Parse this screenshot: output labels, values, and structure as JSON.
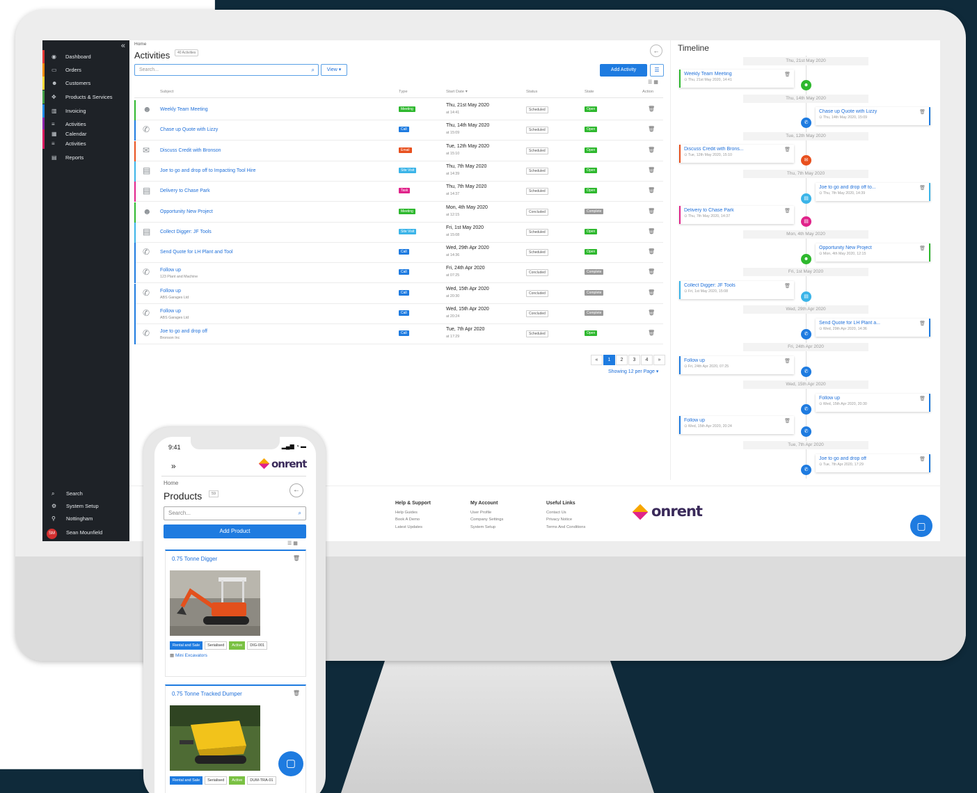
{
  "sidebar": {
    "items": [
      {
        "label": "Dashboard",
        "icon": "dashboard-icon",
        "color": "#e53935"
      },
      {
        "label": "Orders",
        "icon": "orders-icon",
        "color": "#fb8c00"
      },
      {
        "label": "Customers",
        "icon": "customers-icon",
        "color": "#fdd835"
      },
      {
        "label": "Products & Services",
        "icon": "products-icon",
        "color": "#43a047"
      },
      {
        "label": "Invoicing",
        "icon": "invoicing-icon",
        "color": "#1e88e5"
      },
      {
        "label": "Activities",
        "icon": "activities-icon",
        "color": "#8e24aa"
      },
      {
        "label": "Calendar",
        "icon": "calendar-icon",
        "color": "#d81b60"
      },
      {
        "label": "Activities",
        "icon": "activities-icon",
        "color": "#d81b60"
      },
      {
        "label": "Reports",
        "icon": "reports-icon",
        "color": ""
      }
    ],
    "bottom": [
      {
        "label": "Search",
        "icon": "search-icon"
      },
      {
        "label": "System Setup",
        "icon": "gear-icon"
      },
      {
        "label": "Nottingham",
        "icon": "location-pin-icon"
      },
      {
        "label": "Sean Mounfield",
        "icon": "avatar",
        "initials": "SM"
      }
    ]
  },
  "main": {
    "breadcrumb": "Home",
    "title": "Activities",
    "count": "40 Activities",
    "search_placeholder": "Search...",
    "view_label": "View ▾",
    "add_label": "Add Activity",
    "columns": [
      "Subject",
      "Type",
      "Start Date ▾",
      "Status",
      "State",
      "Action"
    ],
    "rows": [
      {
        "subject": "Weekly Team Meeting",
        "sub": "",
        "type": "Meeting",
        "type_color": "#2eb82e",
        "date": "Thu, 21st May 2020",
        "time": "at 14:41",
        "status": "Scheduled",
        "state": "Open",
        "state_color": "#2eb82e",
        "bar": "#2eb82e",
        "icon": "meeting-icon"
      },
      {
        "subject": "Chase up Quote with Lizzy",
        "sub": "",
        "type": "Call",
        "type_color": "#1e7be0",
        "date": "Thu, 14th May 2020",
        "time": "at 15:09",
        "status": "Scheduled",
        "state": "Open",
        "state_color": "#2eb82e",
        "bar": "#1e7be0",
        "icon": "phone-icon"
      },
      {
        "subject": "Discuss Credit with Bronson",
        "sub": "",
        "type": "Email",
        "type_color": "#e8501e",
        "date": "Tue, 12th May 2020",
        "time": "at 15:10",
        "status": "Scheduled",
        "state": "Open",
        "state_color": "#2eb82e",
        "bar": "#e8501e",
        "icon": "email-icon"
      },
      {
        "subject": "Joe to go and drop off to Impacting Tool Hire",
        "sub": "",
        "type": "Site Visit",
        "type_color": "#3bb4e8",
        "date": "Thu, 7th May 2020",
        "time": "at 14:39",
        "status": "Scheduled",
        "state": "Open",
        "state_color": "#2eb82e",
        "bar": "#3bb4e8",
        "icon": "site-visit-icon"
      },
      {
        "subject": "Delivery to Chase Park",
        "sub": "",
        "type": "Task",
        "type_color": "#e0238a",
        "date": "Thu, 7th May 2020",
        "time": "at 14:37",
        "status": "Scheduled",
        "state": "Open",
        "state_color": "#2eb82e",
        "bar": "#e0238a",
        "icon": "task-icon"
      },
      {
        "subject": "Opportunity New Project",
        "sub": "",
        "type": "Meeting",
        "type_color": "#2eb82e",
        "date": "Mon, 4th May 2020",
        "time": "at 12:15",
        "status": "Concluded",
        "state": "Complete",
        "state_color": "#999999",
        "bar": "#2eb82e",
        "icon": "meeting-icon"
      },
      {
        "subject": "Collect Digger: JF Tools",
        "sub": "",
        "type": "Site Visit",
        "type_color": "#3bb4e8",
        "date": "Fri, 1st May 2020",
        "time": "at 15:08",
        "status": "Scheduled",
        "state": "Open",
        "state_color": "#2eb82e",
        "bar": "#3bb4e8",
        "icon": "site-visit-icon"
      },
      {
        "subject": "Send Quote for LH Plant and Tool",
        "sub": "",
        "type": "Call",
        "type_color": "#1e7be0",
        "date": "Wed, 29th Apr 2020",
        "time": "at 14:36",
        "status": "Scheduled",
        "state": "Open",
        "state_color": "#2eb82e",
        "bar": "#1e7be0",
        "icon": "phone-icon"
      },
      {
        "subject": "Follow up",
        "sub": "123 Plant and Machine",
        "type": "Call",
        "type_color": "#1e7be0",
        "date": "Fri, 24th Apr 2020",
        "time": "at 07:25",
        "status": "Concluded",
        "state": "Complete",
        "state_color": "#999999",
        "bar": "#1e7be0",
        "icon": "phone-icon"
      },
      {
        "subject": "Follow up",
        "sub": "ABS Garages Ltd",
        "type": "Call",
        "type_color": "#1e7be0",
        "date": "Wed, 15th Apr 2020",
        "time": "at 20:30",
        "status": "Concluded",
        "state": "Complete",
        "state_color": "#999999",
        "bar": "#1e7be0",
        "icon": "phone-icon"
      },
      {
        "subject": "Follow up",
        "sub": "ABS Garages Ltd",
        "type": "Call",
        "type_color": "#1e7be0",
        "date": "Wed, 15th Apr 2020",
        "time": "at 20:24",
        "status": "Concluded",
        "state": "Complete",
        "state_color": "#999999",
        "bar": "#1e7be0",
        "icon": "phone-icon"
      },
      {
        "subject": "Joe to go and drop off",
        "sub": "Bronson Inc",
        "type": "Call",
        "type_color": "#1e7be0",
        "date": "Tue, 7th Apr 2020",
        "time": "at 17:29",
        "status": "Scheduled",
        "state": "Open",
        "state_color": "#2eb82e",
        "bar": "#1e7be0",
        "icon": "phone-icon"
      }
    ],
    "pager": [
      "«",
      "1",
      "2",
      "3",
      "4",
      "»"
    ],
    "per_page": "Showing 12 per Page ▾"
  },
  "timeline": {
    "title": "Timeline",
    "dates": [
      "Thu, 21st May 2020",
      "Thu, 14th May 2020",
      "Tue, 12th May 2020",
      "Thu, 7th May 2020",
      "Mon, 4th May 2020",
      "Fri, 1st May 2020",
      "Wed, 29th Apr 2020",
      "Fri, 24th Apr 2020",
      "Wed, 15th Apr 2020",
      "Tue, 7th Apr 2020"
    ],
    "cards": [
      {
        "title": "Weekly Team Meeting",
        "meta": "⊙ Thu, 21st May 2020, 14:41",
        "side": "left",
        "color": "#2eb82e"
      },
      {
        "title": "Chase up Quote with Lizzy",
        "meta": "⊙ Thu, 14th May 2020, 15:09",
        "side": "right",
        "color": "#1e7be0"
      },
      {
        "title": "Discuss Credit with Brons...",
        "meta": "⊙ Tue, 12th May 2020, 15:10",
        "side": "left",
        "color": "#e8501e"
      },
      {
        "title": "Joe to go and drop off to...",
        "meta": "⊙ Thu, 7th May 2020, 14:39",
        "side": "right",
        "color": "#3bb4e8"
      },
      {
        "title": "Delivery to Chase Park",
        "meta": "⊙ Thu, 7th May 2020, 14:37",
        "side": "left",
        "color": "#e0238a"
      },
      {
        "title": "Opportunity New Project",
        "meta": "⊙ Mon, 4th May 2020, 12:15",
        "side": "right",
        "color": "#2eb82e"
      },
      {
        "title": "Collect Digger: JF Tools",
        "meta": "⊙ Fri, 1st May 2020, 15:08",
        "side": "left",
        "color": "#3bb4e8"
      },
      {
        "title": "Send Quote for LH Plant a...",
        "meta": "⊙ Wed, 29th Apr 2020, 14:36",
        "side": "right",
        "color": "#1e7be0"
      },
      {
        "title": "Follow up",
        "meta": "⊙ Fri, 24th Apr 2020, 07:25",
        "side": "left",
        "color": "#1e7be0"
      },
      {
        "title": "Follow up",
        "meta": "⊙ Wed, 15th Apr 2020, 20:30",
        "side": "right",
        "color": "#1e7be0"
      },
      {
        "title": "Follow up",
        "meta": "⊙ Wed, 15th Apr 2020, 20:24",
        "side": "left",
        "color": "#1e7be0"
      },
      {
        "title": "Joe to go and drop off",
        "meta": "⊙ Tue, 7th Apr 2020, 17:29",
        "side": "right",
        "color": "#1e7be0"
      }
    ]
  },
  "footer": {
    "cols": [
      {
        "heading": "Help & Support",
        "links": [
          "Help Guides",
          "Book A Demo",
          "Latest Updates"
        ]
      },
      {
        "heading": "My Account",
        "links": [
          "User Profile",
          "Company Settings",
          "System Setup"
        ]
      },
      {
        "heading": "Useful Links",
        "links": [
          "Contact Us",
          "Privacy Notice",
          "Terms And Conditions"
        ]
      }
    ],
    "brand": "onrent"
  },
  "phone": {
    "time": "9:41",
    "brand": "onrent",
    "breadcrumb": "Home",
    "title": "Products",
    "count": "59",
    "search_placeholder": "Search...",
    "add_label": "Add Product",
    "products": [
      {
        "name": "0.75 Tonne Digger",
        "badges": [
          "Rental and Sale",
          "Serialised",
          "Active",
          "DIG-001"
        ],
        "category": "Mini Excavators"
      },
      {
        "name": "0.75 Tonne Tracked Dumper",
        "badges": [
          "Rental and Sale",
          "Serialised",
          "Active",
          "DUM-TRA-01"
        ],
        "category": ""
      }
    ]
  },
  "colors": {
    "accent": "#1e7be0",
    "sidebar_bg": "#1e2227",
    "brand_purple": "#3a2a5a"
  }
}
